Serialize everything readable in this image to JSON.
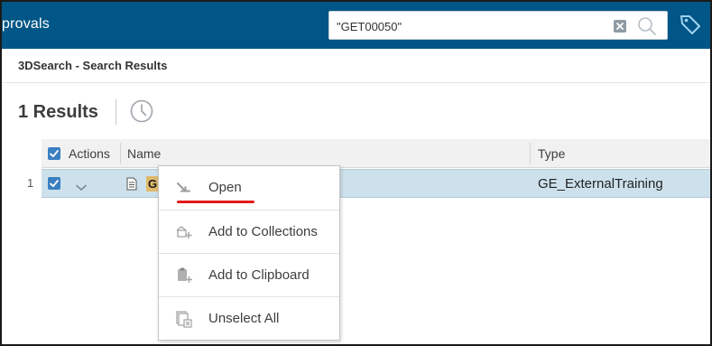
{
  "app": {
    "title_fragment": "provals"
  },
  "search": {
    "value": "\"GET00050\"",
    "placeholder": ""
  },
  "breadcrumb": {
    "title": "3DSearch - Search Results"
  },
  "results": {
    "count_label": "1 Results"
  },
  "table": {
    "columns": [
      "Actions",
      "Name",
      "Type"
    ],
    "rows": [
      {
        "index": "1",
        "name_visible": "G",
        "type": "GE_ExternalTraining",
        "selected": true
      }
    ]
  },
  "context_menu": {
    "items": [
      {
        "label": "Open",
        "icon": "open-arrow-icon"
      },
      {
        "label": "Add to Collections",
        "icon": "add-to-collections-icon"
      },
      {
        "label": "Add to Clipboard",
        "icon": "add-to-clipboard-icon"
      },
      {
        "label": "Unselect All",
        "icon": "unselect-all-icon"
      }
    ]
  },
  "colors": {
    "topbar": "#005686",
    "checkbox": "#3a7fc1",
    "selected_row": "#cde1ec",
    "highlight": "#e0b96a",
    "annotation_underline": "#e31b1b"
  }
}
